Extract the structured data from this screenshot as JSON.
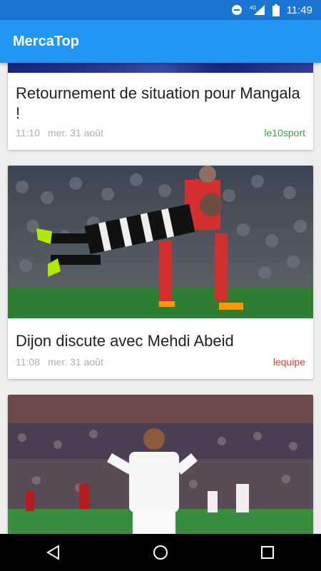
{
  "status_bar": {
    "network": "4G",
    "time": "11:49",
    "icons": [
      "do-not-disturb-icon",
      "signal-4g-icon",
      "battery-icon"
    ]
  },
  "app": {
    "title": "MercaTop"
  },
  "colors": {
    "status_bar": "#1976d2",
    "app_bar": "#2196f3",
    "le10sport": "#43a047",
    "lequipe": "#e53935"
  },
  "articles": [
    {
      "title": "Retournement de situation pour Mangala !",
      "time": "11:10",
      "date": "mer. 31 août",
      "source": "le10sport",
      "image": "football-match-image"
    },
    {
      "title": "Dijon discute avec Mehdi Abeid",
      "time": "11:08",
      "date": "mer. 31 août",
      "source": "lequipe",
      "image": "newcastle-player-diving-image"
    },
    {
      "title": "",
      "time": "",
      "date": "",
      "source": "",
      "image": "real-madrid-player-stadium-image"
    }
  ],
  "nav": [
    "back-icon",
    "home-icon",
    "recents-icon"
  ]
}
